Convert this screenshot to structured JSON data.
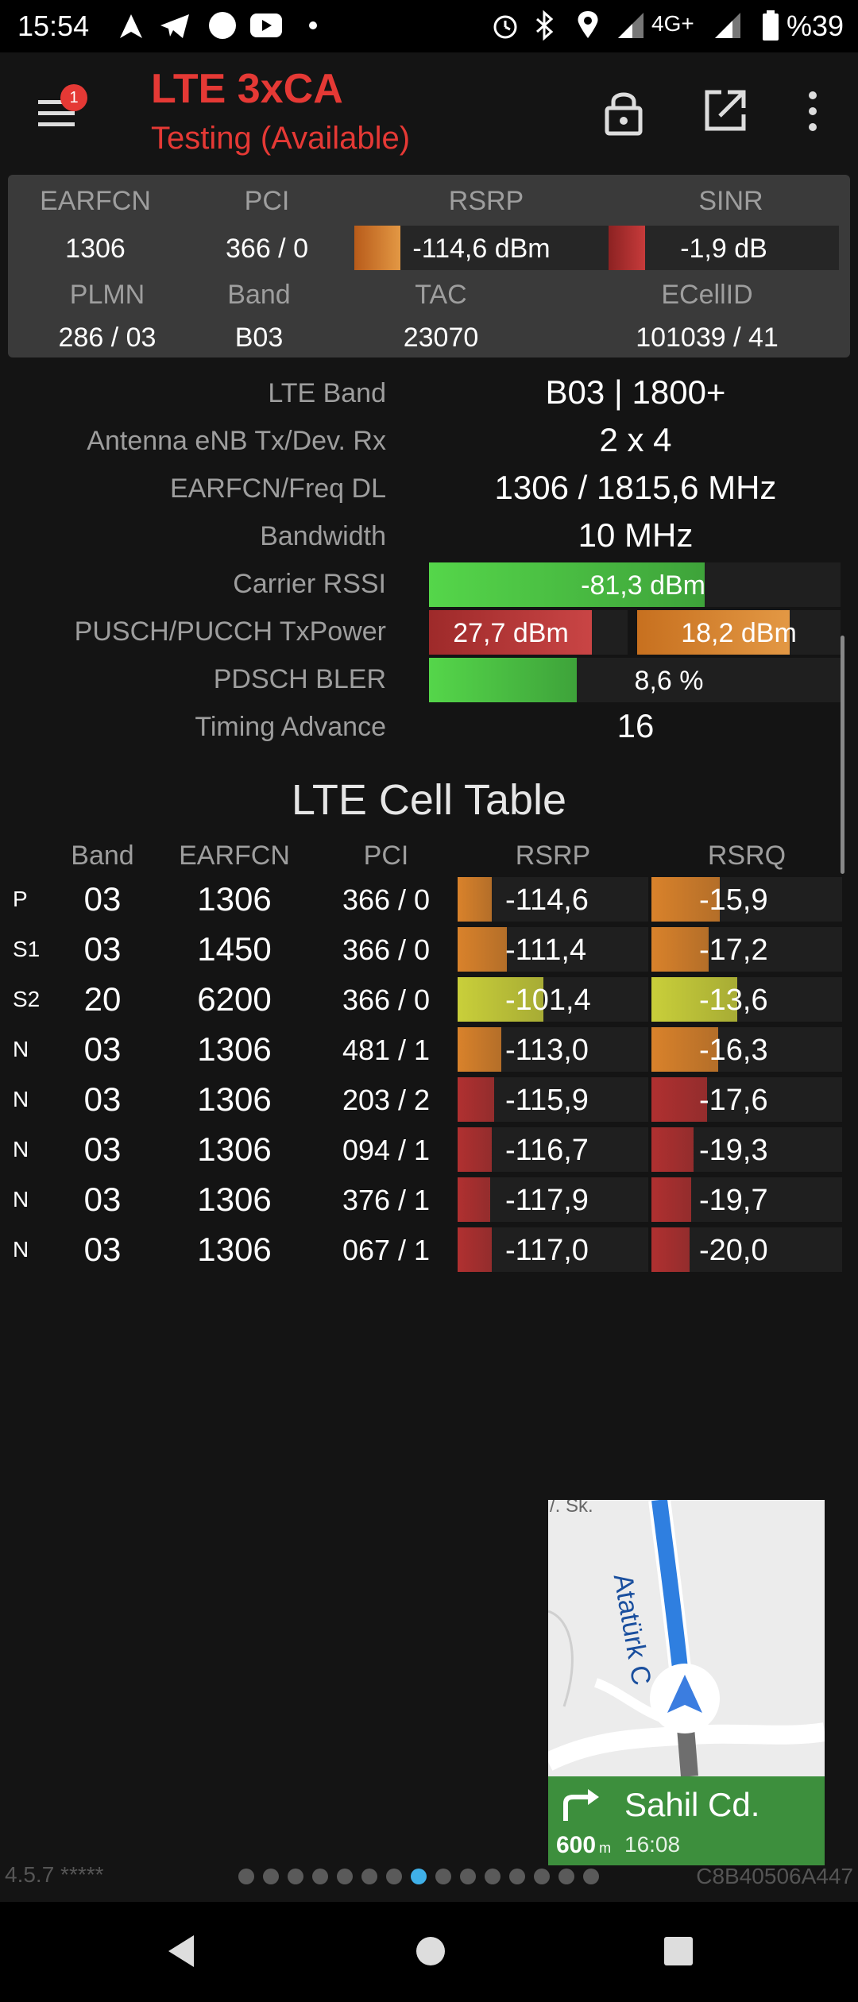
{
  "status_bar": {
    "time": "15:54",
    "network": "4G+",
    "battery": "%39",
    "icons": [
      "navigation-icon",
      "telegram-icon",
      "circle-icon",
      "youtube-icon",
      "dot-icon",
      "alarm-icon",
      "bluetooth-icon",
      "location-icon",
      "signal-icon",
      "signal-icon",
      "battery-icon"
    ]
  },
  "app_bar": {
    "badge": "1",
    "title": "LTE 3xCA",
    "subtitle": "Testing (Available)"
  },
  "summary": {
    "h_earfcn": "EARFCN",
    "h_pci": "PCI",
    "h_rsrp": "RSRP",
    "h_sinr": "SINR",
    "earfcn": "1306",
    "pci": "366 / 0",
    "rsrp": "-114,6 dBm",
    "sinr": "-1,9 dB",
    "rsrp_level": 0.18,
    "sinr_level": 0.16,
    "h_plmn": "PLMN",
    "h_band": "Band",
    "h_tac": "TAC",
    "h_ecellid": "ECellID",
    "plmn": "286 / 03",
    "band": "B03",
    "tac": "23070",
    "ecellid": "101039 / 41"
  },
  "info": {
    "lte_band_label": "LTE Band",
    "lte_band": "B03 | 1800+",
    "antenna_label": "Antenna eNB Tx/Dev. Rx",
    "antenna": "2 x 4",
    "earfcn_label": "EARFCN/Freq DL",
    "earfcn": "1306 / 1815,6 MHz",
    "bandwidth_label": "Bandwidth",
    "bandwidth": "10 MHz",
    "rssi_label": "Carrier RSSI",
    "rssi": "-81,3 dBm",
    "rssi_level": 0.67,
    "txpower_label": "PUSCH/PUCCH TxPower",
    "pusch": "27,7 dBm",
    "pucch": "18,2 dBm",
    "pusch_level": 0.82,
    "pucch_level": 0.75,
    "bler_label": "PDSCH BLER",
    "bler": "8,6 %",
    "bler_level": 0.36,
    "ta_label": "Timing Advance",
    "ta": "16"
  },
  "cell_table": {
    "title": "LTE Cell Table",
    "headers": {
      "band": "Band",
      "earfcn": "EARFCN",
      "pci": "PCI",
      "rsrp": "RSRP",
      "rsrq": "RSRQ"
    },
    "rows": [
      {
        "type": "P",
        "band": "03",
        "earfcn": "1306",
        "pci": "366 / 0",
        "rsrp": "-114,6",
        "rsrq": "-15,9",
        "rsrp_level": 0.18,
        "rsrq_level": 0.36,
        "color": "#d9822b"
      },
      {
        "type": "S1",
        "band": "03",
        "earfcn": "1450",
        "pci": "366 / 0",
        "rsrp": "-111,4",
        "rsrq": "-17,2",
        "rsrp_level": 0.26,
        "rsrq_level": 0.3,
        "color": "#d9822b"
      },
      {
        "type": "S2",
        "band": "20",
        "earfcn": "6200",
        "pci": "366 / 0",
        "rsrp": "-101,4",
        "rsrq": "-13,6",
        "rsrp_level": 0.45,
        "rsrq_level": 0.45,
        "color": "#c9cf3a"
      },
      {
        "type": "N",
        "band": "03",
        "earfcn": "1306",
        "pci": "481 / 1",
        "rsrp": "-113,0",
        "rsrq": "-16,3",
        "rsrp_level": 0.23,
        "rsrq_level": 0.35,
        "color": "#d9822b"
      },
      {
        "type": "N",
        "band": "03",
        "earfcn": "1306",
        "pci": "203 / 2",
        "rsrp": "-115,9",
        "rsrq": "-17,6",
        "rsrp_level": 0.19,
        "rsrq_level": 0.29,
        "color": "#b03030"
      },
      {
        "type": "N",
        "band": "03",
        "earfcn": "1306",
        "pci": "094 / 1",
        "rsrp": "-116,7",
        "rsrq": "-19,3",
        "rsrp_level": 0.18,
        "rsrq_level": 0.22,
        "color": "#b03030"
      },
      {
        "type": "N",
        "band": "03",
        "earfcn": "1306",
        "pci": "376 / 1",
        "rsrp": "-117,9",
        "rsrq": "-19,7",
        "rsrp_level": 0.17,
        "rsrq_level": 0.21,
        "color": "#b03030"
      },
      {
        "type": "N",
        "band": "03",
        "earfcn": "1306",
        "pci": "067 / 1",
        "rsrp": "-117,0",
        "rsrq": "-20,0",
        "rsrp_level": 0.18,
        "rsrq_level": 0.2,
        "color": "#b03030"
      }
    ]
  },
  "map_overlay": {
    "street_top": "Atatürk C",
    "street_small": "/. Sk.",
    "direction_street": "Sahil Cd.",
    "distance": "600",
    "distance_unit": "m",
    "eta": "16:08"
  },
  "footer": {
    "version": "4.5.7 *****",
    "device_id": "C8B40506A447",
    "pages": 15,
    "active_page": 7
  },
  "colors": {
    "accent_red": "#e53935",
    "bar_green": "#4caf50",
    "bar_orange": "#d9822b",
    "bar_red": "#b03030",
    "bar_yellow": "#c9cf3a"
  }
}
